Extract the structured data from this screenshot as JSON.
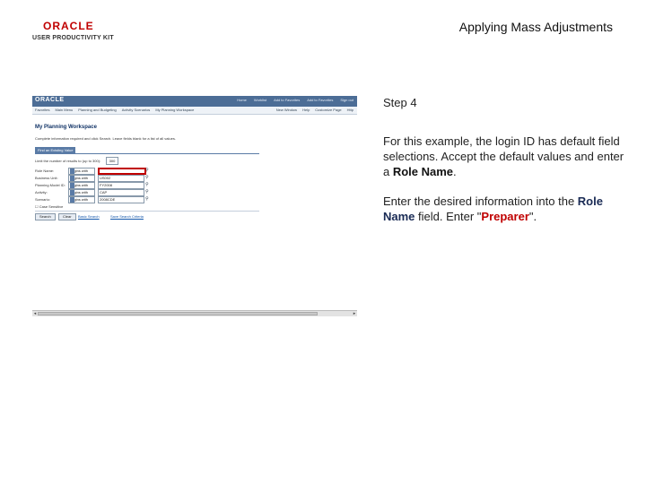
{
  "header": {
    "brand": "ORACLE",
    "product": "USER PRODUCTIVITY KIT",
    "topic_title": "Applying Mass Adjustments"
  },
  "screenshot": {
    "oracle_bar": {
      "brand": "ORACLE",
      "links": [
        "Home",
        "Worklist",
        "Add to Favorites",
        "Add to Favorites",
        "Sign out"
      ]
    },
    "menu": {
      "items": [
        "Favorites",
        "Main Menu",
        "Planning and Budgeting",
        "Activity Scenarios",
        "My Planning Workspace"
      ],
      "right": [
        "New Window",
        "Help",
        "Customize Page",
        "Http"
      ]
    },
    "workspace_title": "My Planning Workspace",
    "instructions": "Complete information required and click Search. Leave fields blank for a list of all values.",
    "tab_label": "Find an Existing Value",
    "limit_label": "Limit the number of results to (up to 300):",
    "limit_value": "300",
    "rows": [
      {
        "label": "Role Name:",
        "op": "begins with",
        "value": ""
      },
      {
        "label": "Business Unit:",
        "op": "begins with",
        "value": "US002"
      },
      {
        "label": "Planning Model ID:",
        "op": "begins with",
        "value": "FY2008"
      },
      {
        "label": "Activity:",
        "op": "begins with",
        "value": "CAP"
      },
      {
        "label": "Scenario:",
        "op": "begins with",
        "value": "2008CDE"
      }
    ],
    "case_sensitive": "Case Sensitive",
    "buttons": {
      "search": "Search",
      "clear": "Clear"
    },
    "links": {
      "basic": "Basic Search",
      "save": "Save Search Criteria"
    }
  },
  "panel": {
    "step": "Step 4",
    "p1_text": "For this example, the login ID has default field selections. Accept the default values and enter a ",
    "p1_keyword": "Role Name",
    "p1_end": ".",
    "p2_text": "Enter the desired information into the ",
    "p2_keyword": "Role Name",
    "p2_mid": " field. Enter \"",
    "p2_value": "Preparer",
    "p2_end": "\"."
  },
  "colors": {
    "brand_red": "#c00000",
    "oracle_blue": "#4c6d96",
    "keyword": "#1a2b55"
  }
}
